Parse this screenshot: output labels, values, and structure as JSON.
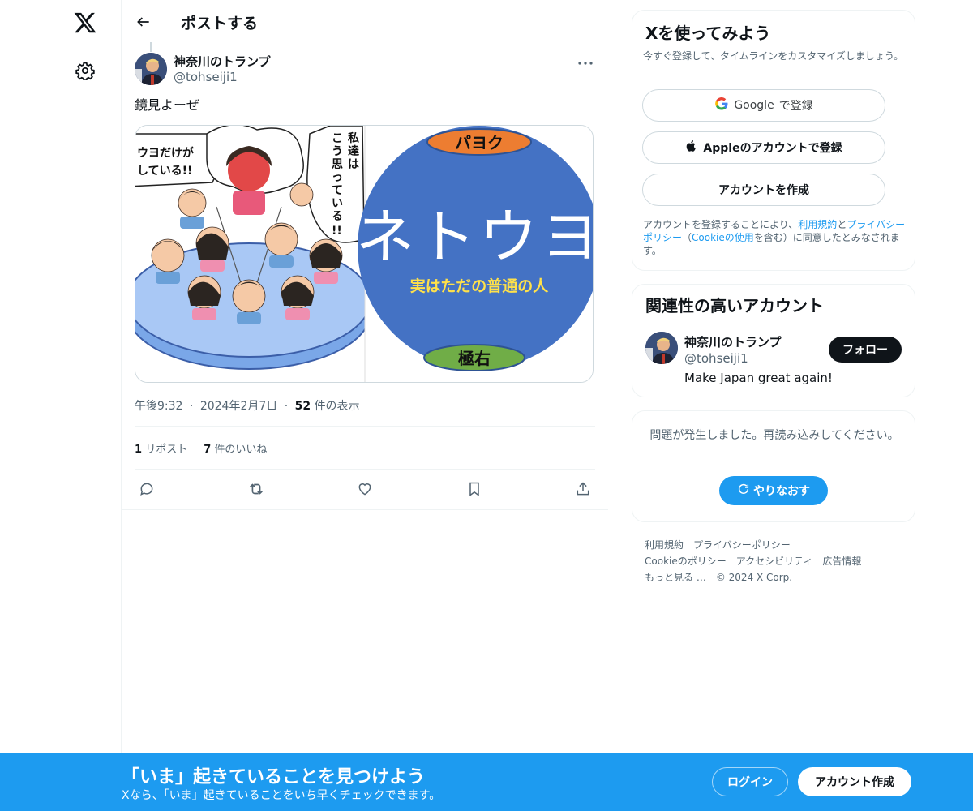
{
  "header": {
    "title": "ポストする"
  },
  "post": {
    "author_name": "神奈川のトランプ",
    "author_handle": "@tohseiji1",
    "text": "鏡見よーぜ",
    "image": {
      "left_panel_bubble_left": "ウヨだけが\nしている!!",
      "left_panel_bubble_right": "私達はこう思っている!!",
      "right_circle_top_label": "パヨク",
      "right_circle_main": "ネトウヨ",
      "right_circle_sub": "実はただの普通の人",
      "right_circle_bottom_label": "極右"
    },
    "time": "午後9:32",
    "date": "2024年2月7日",
    "views_count": "52",
    "views_label": "件の表示",
    "reposts_count": "1",
    "reposts_label": "リポスト",
    "likes_count": "7",
    "likes_label": "件のいいね",
    "meta_separator": "·"
  },
  "signup": {
    "title": "Xを使ってみよう",
    "subtitle": "今すぐ登録して、タイムラインをカスタマイズしましょう。",
    "google_brand": "Google",
    "google_label": "で登録",
    "apple_label": "Appleのアカウントで登録",
    "create_label": "アカウントを作成",
    "terms_prefix": "アカウントを登録することにより、",
    "terms_link": "利用規約",
    "terms_and": "と",
    "privacy_link": "プライバシーポリシー",
    "terms_open": "（",
    "cookie_link": "Cookieの使用",
    "terms_suffix": "を含む）に同意したとみなされます。"
  },
  "related": {
    "title": "関連性の高いアカウント",
    "name": "神奈川のトランプ",
    "handle": "@tohseiji1",
    "bio": "Make Japan great again!",
    "follow_label": "フォロー"
  },
  "error": {
    "message": "問題が発生しました。再読み込みしてください。",
    "retry_label": "やりなおす"
  },
  "footer": {
    "links": [
      "利用規約",
      "プライバシーポリシー",
      "Cookieのポリシー",
      "アクセシビリティ",
      "広告情報",
      "もっと見る …"
    ],
    "copyright": "© 2024 X Corp."
  },
  "banner": {
    "title": "「いま」起きていることを見つけよう",
    "subtitle": "Xなら、「いま」起きていることをいち早くチェックできます。",
    "login_label": "ログイン",
    "create_label": "アカウント作成"
  },
  "colors": {
    "accent": "#1d9bf0",
    "text": "#0f1419",
    "secondary": "#536471",
    "circle_blue": "#4472c4",
    "label_orange": "#ed7d31",
    "label_green": "#70ad47"
  }
}
